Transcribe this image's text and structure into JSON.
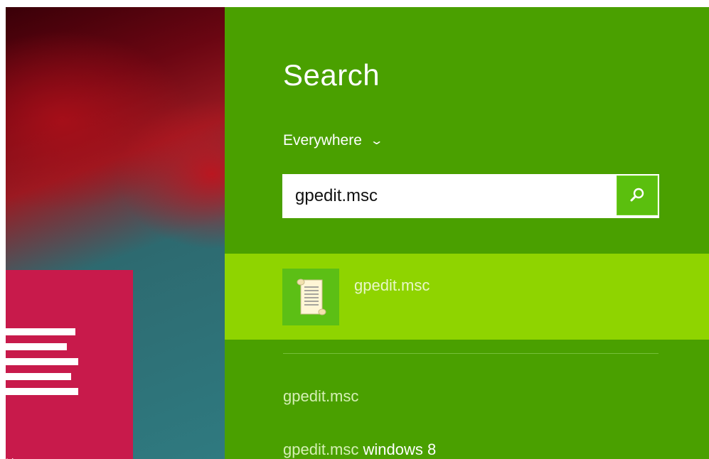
{
  "start_screen": {
    "tile_label": "List"
  },
  "charm": {
    "title": "Search",
    "scope_label": "Everywhere",
    "search": {
      "value": "gpedit.msc",
      "placeholder": ""
    },
    "search_button_icon": "search-icon",
    "top_result": {
      "label": "gpedit.msc",
      "icon": "scroll-document-icon"
    },
    "suggestions": [
      {
        "query": "gpedit.msc",
        "extra": ""
      },
      {
        "query": "gpedit.msc",
        "extra": " windows 8"
      }
    ]
  },
  "colors": {
    "charm_background": "#4aa000",
    "selected_result": "#8fd400",
    "tile": "#c81a4b"
  }
}
